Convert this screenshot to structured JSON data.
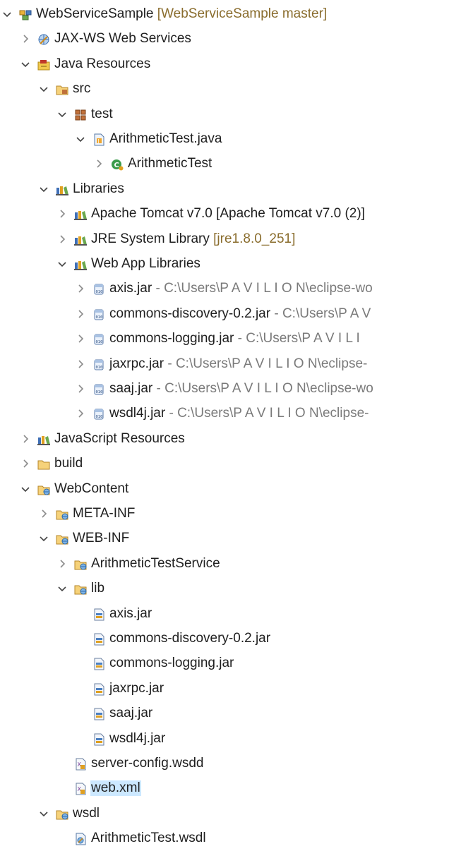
{
  "tree": [
    {
      "label": "WebServiceSample",
      "decor": " [WebServiceSample master]",
      "decor_style": "gold",
      "icon": "project-icon",
      "state": "expanded",
      "depth": 0,
      "item_name": "project-webservicesample"
    },
    {
      "label": "JAX-WS Web Services",
      "icon": "web-services-icon",
      "state": "collapsed",
      "depth": 1,
      "item_name": "jax-ws-web-services"
    },
    {
      "label": "Java Resources",
      "icon": "java-resources-icon",
      "state": "expanded",
      "depth": 1,
      "item_name": "java-resources"
    },
    {
      "label": "src",
      "icon": "source-folder-icon",
      "state": "expanded",
      "depth": 2,
      "item_name": "src-folder"
    },
    {
      "label": "test",
      "icon": "package-icon",
      "state": "expanded",
      "depth": 3,
      "item_name": "package-test"
    },
    {
      "label": "ArithmeticTest.java",
      "icon": "java-file-icon",
      "state": "expanded",
      "depth": 4,
      "item_name": "arithmetictest-java"
    },
    {
      "label": "ArithmeticTest",
      "icon": "class-icon",
      "state": "collapsed",
      "depth": 5,
      "item_name": "class-arithmetictest"
    },
    {
      "label": "Libraries",
      "icon": "library-icon",
      "state": "expanded",
      "depth": 2,
      "item_name": "libraries"
    },
    {
      "label": "Apache Tomcat v7.0 [Apache Tomcat v7.0 (2)]",
      "icon": "library-icon",
      "state": "collapsed",
      "depth": 3,
      "item_name": "apache-tomcat-library"
    },
    {
      "label": "JRE System Library",
      "decor": " [jre1.8.0_251]",
      "decor_style": "gold",
      "icon": "library-icon",
      "state": "collapsed",
      "depth": 3,
      "item_name": "jre-system-library"
    },
    {
      "label": "Web App Libraries",
      "icon": "library-icon",
      "state": "expanded",
      "depth": 3,
      "item_name": "web-app-libraries"
    },
    {
      "label": "axis.jar",
      "decor": " - C:\\Users\\P A V I L I O N\\eclipse-wo",
      "decor_style": "gray",
      "icon": "jar-icon",
      "state": "collapsed",
      "depth": 4,
      "item_name": "lib-axis-jar"
    },
    {
      "label": "commons-discovery-0.2.jar",
      "decor": " - C:\\Users\\P A V",
      "decor_style": "gray",
      "icon": "jar-icon",
      "state": "collapsed",
      "depth": 4,
      "item_name": "lib-commons-discovery-jar"
    },
    {
      "label": "commons-logging.jar",
      "decor": " - C:\\Users\\P A V I L I",
      "decor_style": "gray",
      "icon": "jar-icon",
      "state": "collapsed",
      "depth": 4,
      "item_name": "lib-commons-logging-jar"
    },
    {
      "label": "jaxrpc.jar",
      "decor": " - C:\\Users\\P A V I L I O N\\eclipse-",
      "decor_style": "gray",
      "icon": "jar-icon",
      "state": "collapsed",
      "depth": 4,
      "item_name": "lib-jaxrpc-jar"
    },
    {
      "label": "saaj.jar",
      "decor": " - C:\\Users\\P A V I L I O N\\eclipse-wo",
      "decor_style": "gray",
      "icon": "jar-icon",
      "state": "collapsed",
      "depth": 4,
      "item_name": "lib-saaj-jar"
    },
    {
      "label": "wsdl4j.jar",
      "decor": " - C:\\Users\\P A V I L I O N\\eclipse-",
      "decor_style": "gray",
      "icon": "jar-icon",
      "state": "collapsed",
      "depth": 4,
      "item_name": "lib-wsdl4j-jar"
    },
    {
      "label": "JavaScript Resources",
      "icon": "library-icon",
      "state": "collapsed",
      "depth": 1,
      "item_name": "javascript-resources"
    },
    {
      "label": "build",
      "icon": "folder-icon",
      "state": "collapsed",
      "depth": 1,
      "item_name": "build-folder"
    },
    {
      "label": "WebContent",
      "icon": "web-folder-icon",
      "state": "expanded",
      "depth": 1,
      "item_name": "webcontent-folder"
    },
    {
      "label": "META-INF",
      "icon": "web-folder-icon",
      "state": "collapsed",
      "depth": 2,
      "item_name": "meta-inf-folder"
    },
    {
      "label": "WEB-INF",
      "icon": "web-folder-icon",
      "state": "expanded",
      "depth": 2,
      "item_name": "web-inf-folder"
    },
    {
      "label": "ArithmeticTestService",
      "icon": "web-folder-icon",
      "state": "collapsed",
      "depth": 3,
      "item_name": "arithmetictestservice-folder"
    },
    {
      "label": "lib",
      "icon": "web-folder-icon",
      "state": "expanded",
      "depth": 3,
      "item_name": "lib-folder"
    },
    {
      "label": "axis.jar",
      "icon": "jar-file-icon",
      "state": "leaf",
      "depth": 4,
      "item_name": "file-axis-jar"
    },
    {
      "label": "commons-discovery-0.2.jar",
      "icon": "jar-file-icon",
      "state": "leaf",
      "depth": 4,
      "item_name": "file-commons-discovery-jar"
    },
    {
      "label": "commons-logging.jar",
      "icon": "jar-file-icon",
      "state": "leaf",
      "depth": 4,
      "item_name": "file-commons-logging-jar"
    },
    {
      "label": "jaxrpc.jar",
      "icon": "jar-file-icon",
      "state": "leaf",
      "depth": 4,
      "item_name": "file-jaxrpc-jar"
    },
    {
      "label": "saaj.jar",
      "icon": "jar-file-icon",
      "state": "leaf",
      "depth": 4,
      "item_name": "file-saaj-jar"
    },
    {
      "label": "wsdl4j.jar",
      "icon": "jar-file-icon",
      "state": "leaf",
      "depth": 4,
      "item_name": "file-wsdl4j-jar"
    },
    {
      "label": "server-config.wsdd",
      "icon": "xml-file-icon",
      "state": "leaf",
      "depth": 3,
      "item_name": "file-server-config-wsdd"
    },
    {
      "label": "web.xml",
      "icon": "xml-file-icon",
      "state": "leaf",
      "depth": 3,
      "selected": true,
      "item_name": "file-web-xml"
    },
    {
      "label": "wsdl",
      "icon": "web-folder-icon",
      "state": "expanded",
      "depth": 2,
      "item_name": "wsdl-folder"
    },
    {
      "label": "ArithmeticTest.wsdl",
      "icon": "wsdl-file-icon",
      "state": "leaf",
      "depth": 3,
      "item_name": "file-arithmetictest-wsdl"
    }
  ],
  "colors": {
    "selection": "#cce8ff",
    "decoration_gold": "#8a6d2e",
    "decoration_gray": "#7a7a7a"
  }
}
